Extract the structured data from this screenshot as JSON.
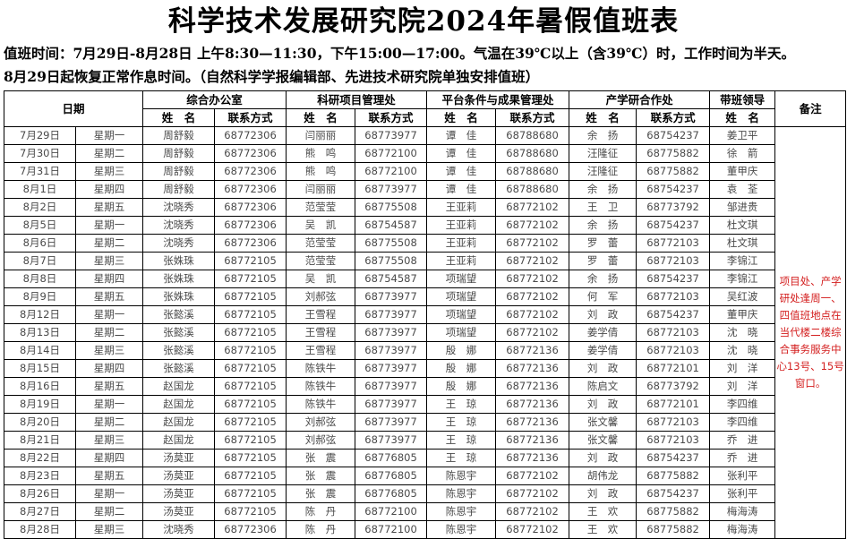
{
  "title": "科学技术发展研究院2024年暑假值班表",
  "note_line1": "值班时间：7月29日-8月28日  上午8:30—11:30，下午15:00—17:00。气温在39℃以上（含39℃）时，工作时间为半天。",
  "note_line2": "8月29日起恢复正常作息时间。（自然科学学报编辑部、先进技术研究院单独安排值班）",
  "headers": {
    "date": "日期",
    "dept1": "综合办公室",
    "dept2": "科研项目管理处",
    "dept3": "平台条件与成果管理处",
    "dept4": "产学研合作处",
    "leader": "带班领导",
    "remark": "备注",
    "name": "姓　名",
    "contact": "联系方式",
    "leader_name": "姓　名"
  },
  "remark": "项目处、产学研处逢周一、四值班地点在当代楼二楼综合事务服务中心13号、15号窗口。",
  "rows": [
    [
      "7月29日",
      "星期一",
      "周舒毅",
      "68772306",
      "闫丽丽",
      "68773977",
      "谭　佳",
      "68788680",
      "余　扬",
      "68754237",
      "姜卫平"
    ],
    [
      "7月30日",
      "星期二",
      "周舒毅",
      "68772306",
      "熊　鸣",
      "68772100",
      "谭　佳",
      "68788680",
      "汪隆征",
      "68775882",
      "徐　箭"
    ],
    [
      "7月31日",
      "星期三",
      "周舒毅",
      "68772306",
      "熊　鸣",
      "68772100",
      "谭　佳",
      "68788680",
      "汪隆征",
      "68775882",
      "董甲庆"
    ],
    [
      "8月1日",
      "星期四",
      "周舒毅",
      "68772306",
      "闫丽丽",
      "68773977",
      "谭　佳",
      "68788680",
      "余　扬",
      "68754237",
      "袁　荃"
    ],
    [
      "8月2日",
      "星期五",
      "沈晓秀",
      "68772306",
      "范莹莹",
      "68775508",
      "王亚莉",
      "68772102",
      "王　卫",
      "68773792",
      "邹进贵"
    ],
    [
      "8月5日",
      "星期一",
      "沈晓秀",
      "68772306",
      "吴　凯",
      "68754587",
      "王亚莉",
      "68772102",
      "余　扬",
      "68754237",
      "杜文琪"
    ],
    [
      "8月6日",
      "星期二",
      "沈晓秀",
      "68772306",
      "范莹莹",
      "68775508",
      "王亚莉",
      "68772102",
      "罗　蕾",
      "68772103",
      "杜文琪"
    ],
    [
      "8月7日",
      "星期三",
      "张姝珠",
      "68772105",
      "范莹莹",
      "68775508",
      "王亚莉",
      "68772102",
      "罗　蕾",
      "68772103",
      "李锦江"
    ],
    [
      "8月8日",
      "星期四",
      "张姝珠",
      "68772105",
      "吴　凯",
      "68754587",
      "项瑞望",
      "68772102",
      "余　扬",
      "68754237",
      "李锦江"
    ],
    [
      "8月9日",
      "星期五",
      "张姝珠",
      "68772105",
      "刘郝弦",
      "68773977",
      "项瑞望",
      "68772102",
      "何　军",
      "68772103",
      "吴红波"
    ],
    [
      "8月12日",
      "星期一",
      "张懿溪",
      "68772105",
      "王雪程",
      "68773977",
      "项瑞望",
      "68772102",
      "刘　政",
      "68754237",
      "董甲庆"
    ],
    [
      "8月13日",
      "星期二",
      "张懿溪",
      "68772105",
      "王雪程",
      "68773977",
      "项瑞望",
      "68772102",
      "姜学倩",
      "68772103",
      "沈　晓"
    ],
    [
      "8月14日",
      "星期三",
      "张懿溪",
      "68772105",
      "王雪程",
      "68773977",
      "殷　娜",
      "68772136",
      "姜学倩",
      "68772103",
      "沈　晓"
    ],
    [
      "8月15日",
      "星期四",
      "张懿溪",
      "68772105",
      "陈铁牛",
      "68773977",
      "殷　娜",
      "68772136",
      "刘　政",
      "68772101",
      "刘　洋"
    ],
    [
      "8月16日",
      "星期五",
      "赵国龙",
      "68772105",
      "陈铁牛",
      "68773977",
      "殷　娜",
      "68772136",
      "陈启文",
      "68773792",
      "刘　洋"
    ],
    [
      "8月19日",
      "星期一",
      "赵国龙",
      "68772105",
      "陈铁牛",
      "68773977",
      "王　琼",
      "68772136",
      "刘　政",
      "68772101",
      "李四维"
    ],
    [
      "8月20日",
      "星期二",
      "赵国龙",
      "68772105",
      "刘郝弦",
      "68773977",
      "王　琼",
      "68772136",
      "张文馨",
      "68772103",
      "李四维"
    ],
    [
      "8月21日",
      "星期三",
      "赵国龙",
      "68772105",
      "刘郝弦",
      "68773977",
      "王　琼",
      "68772136",
      "张文馨",
      "68772103",
      "乔　进"
    ],
    [
      "8月22日",
      "星期四",
      "汤莫亚",
      "68772105",
      "张　震",
      "68776805",
      "王　琼",
      "68772136",
      "刘　政",
      "68754237",
      "乔　进"
    ],
    [
      "8月23日",
      "星期五",
      "汤莫亚",
      "68772105",
      "张　震",
      "68776805",
      "陈恩宇",
      "68772102",
      "胡伟龙",
      "68775882",
      "张利平"
    ],
    [
      "8月26日",
      "星期一",
      "汤莫亚",
      "68772105",
      "张　震",
      "68776805",
      "陈恩宇",
      "68772102",
      "刘　政",
      "68754237",
      "张利平"
    ],
    [
      "8月27日",
      "星期二",
      "汤莫亚",
      "68772105",
      "陈　丹",
      "68772100",
      "陈恩宇",
      "68772102",
      "王　欢",
      "68775882",
      "梅海涛"
    ],
    [
      "8月28日",
      "星期三",
      "沈晓秀",
      "68772306",
      "陈　丹",
      "68772100",
      "陈恩宇",
      "68772102",
      "王　欢",
      "68775882",
      "梅海涛"
    ]
  ]
}
